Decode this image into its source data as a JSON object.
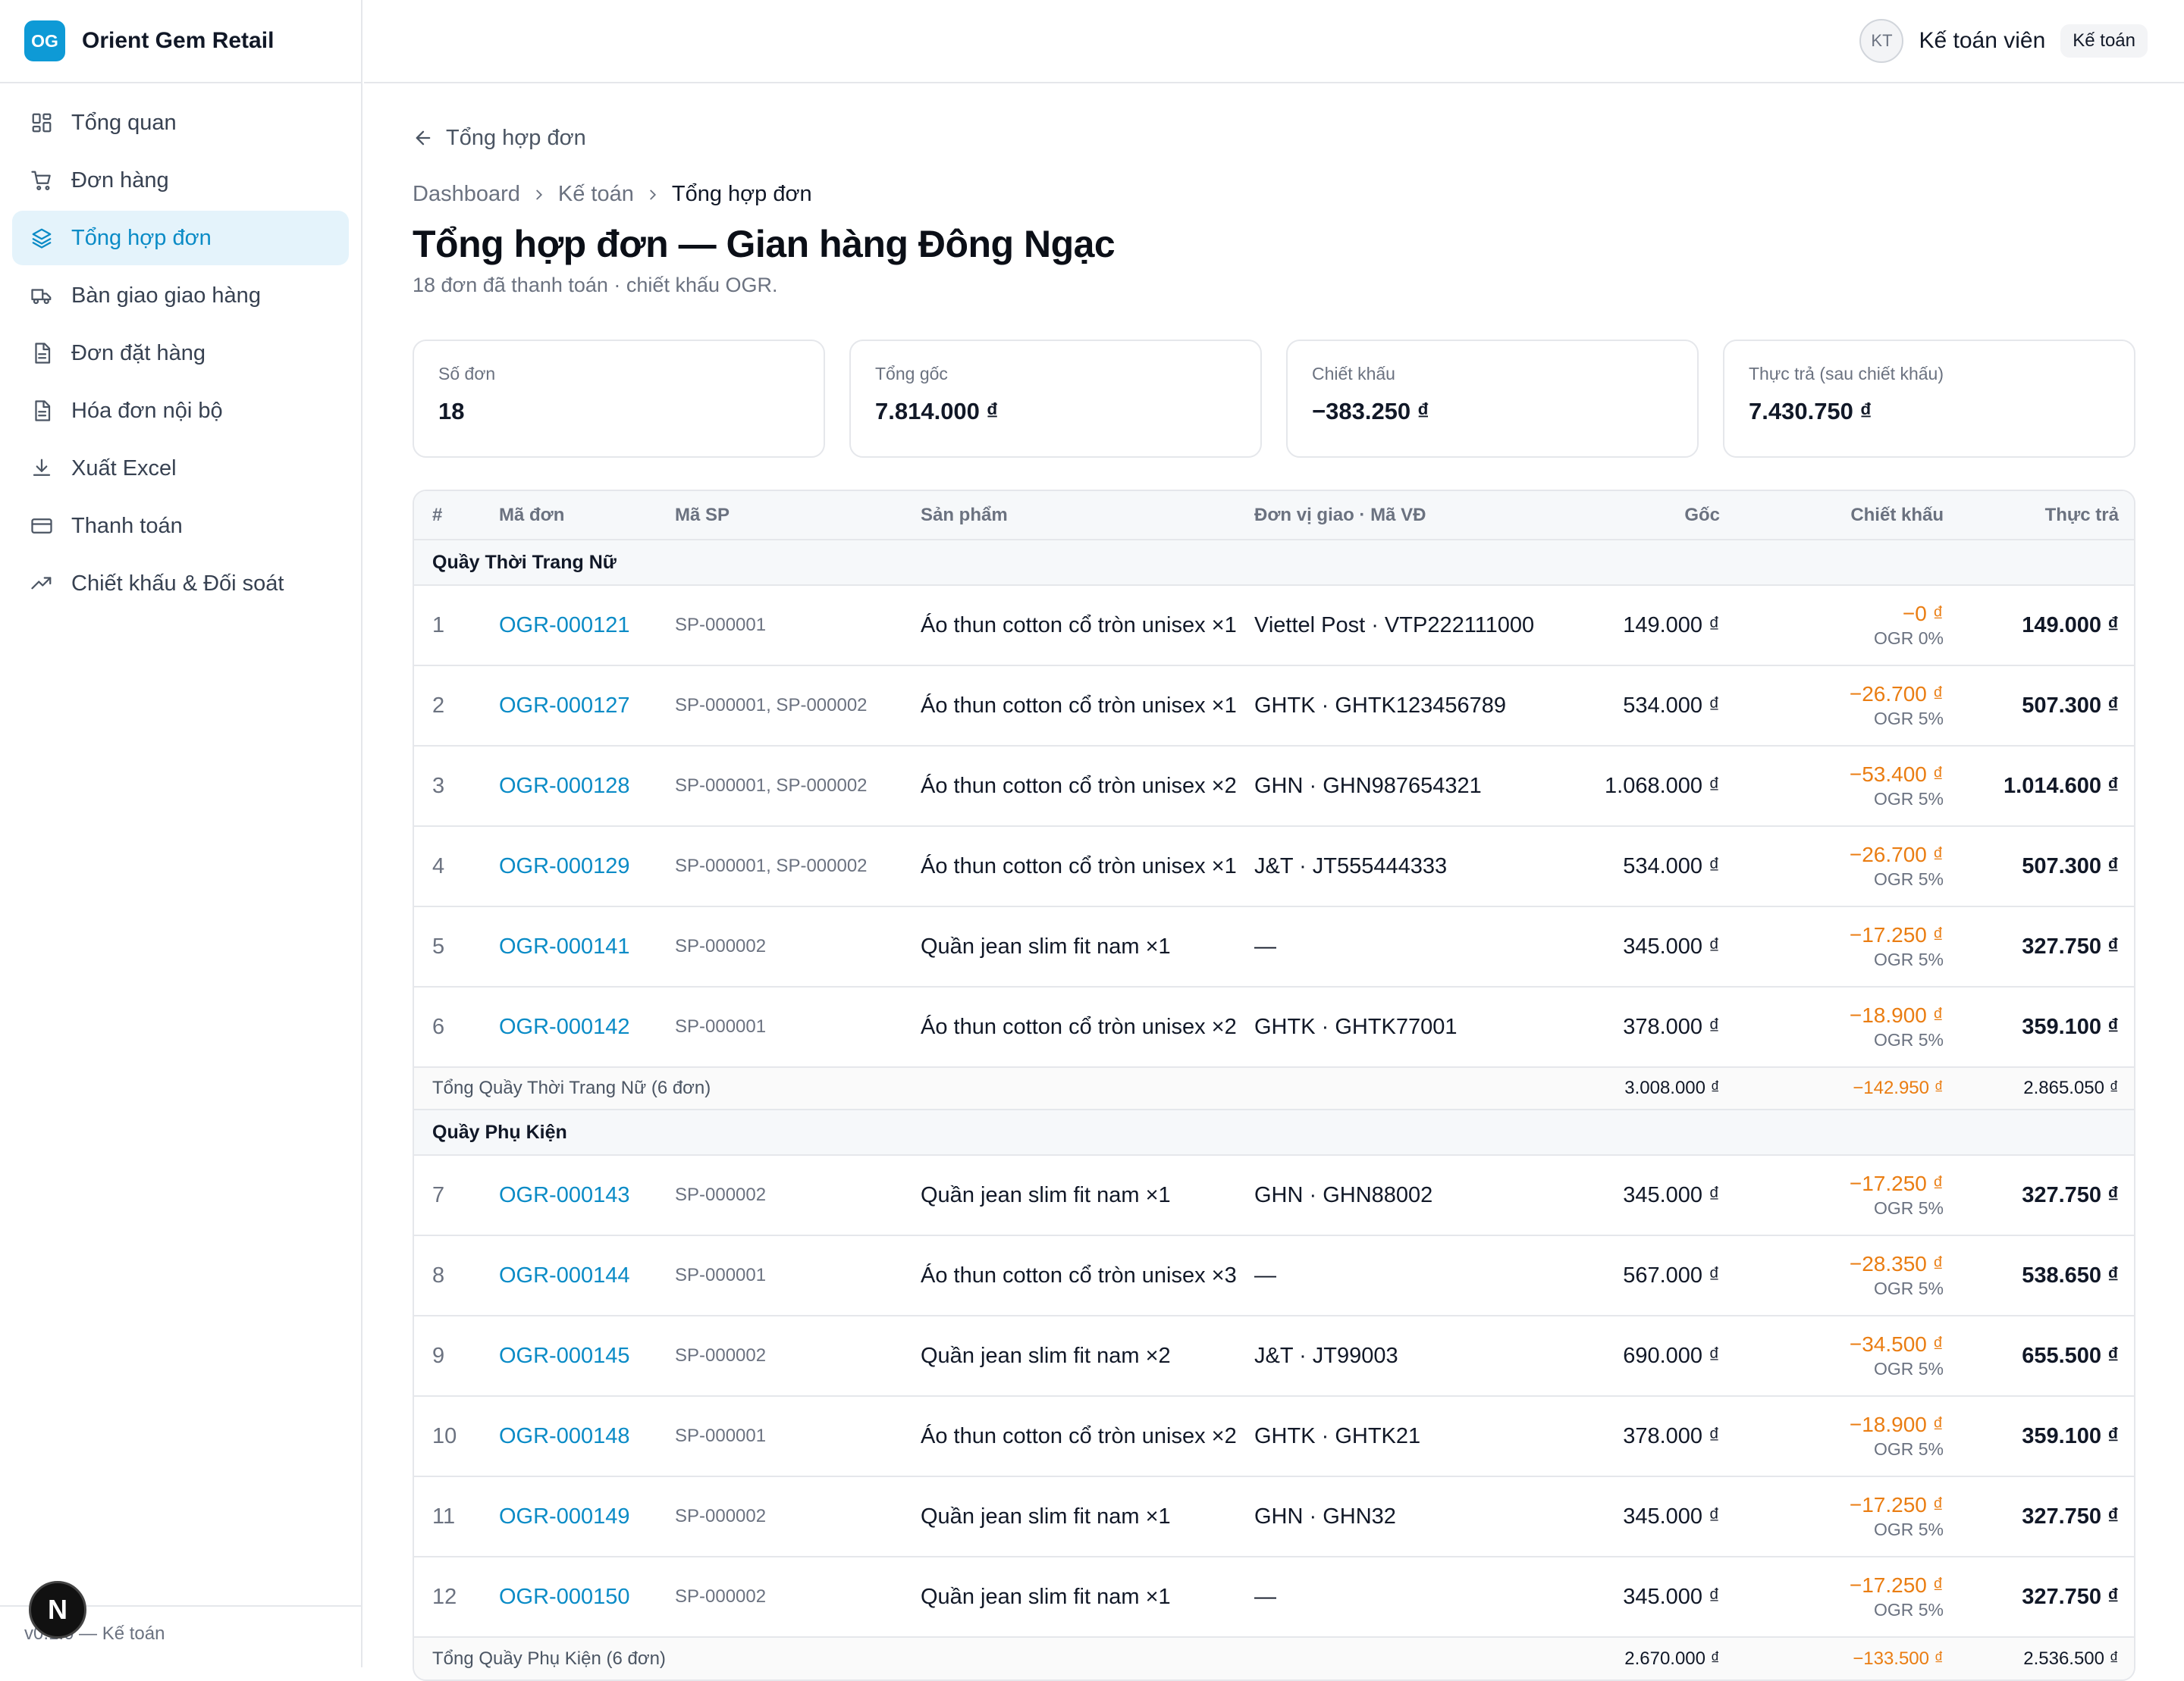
{
  "app": {
    "logo": "OG",
    "name": "Orient Gem Retail",
    "footer": "v0.1.0 — Kế toán",
    "dev_badge": "N"
  },
  "sidebar": {
    "items": [
      {
        "label": "Tổng quan",
        "icon": "dashboard-icon"
      },
      {
        "label": "Đơn hàng",
        "icon": "cart-icon"
      },
      {
        "label": "Tổng hợp đơn",
        "icon": "layers-icon",
        "active": true
      },
      {
        "label": "Bàn giao giao hàng",
        "icon": "truck-icon"
      },
      {
        "label": "Đơn đặt hàng",
        "icon": "document-icon"
      },
      {
        "label": "Hóa đơn nội bộ",
        "icon": "document-icon"
      },
      {
        "label": "Xuất Excel",
        "icon": "download-icon"
      },
      {
        "label": "Thanh toán",
        "icon": "credit-card-icon"
      },
      {
        "label": "Chiết khấu & Đối soát",
        "icon": "trend-icon"
      }
    ]
  },
  "topbar": {
    "avatar": "KT",
    "user": "Kế toán viên",
    "role": "Kế toán"
  },
  "page": {
    "back": "Tổng hợp đơn",
    "breadcrumb": [
      "Dashboard",
      "Kế toán",
      "Tổng hợp đơn"
    ],
    "title": "Tổng hợp đơn — Gian hàng Đông Ngạc",
    "subtitle": "18 đơn đã thanh toán · chiết khấu OGR."
  },
  "stats": [
    {
      "label": "Số đơn",
      "value": "18"
    },
    {
      "label": "Tổng gốc",
      "value": "7.814.000 ₫"
    },
    {
      "label": "Chiết khấu",
      "value": "−383.250 ₫"
    },
    {
      "label": "Thực trả (sau chiết khấu)",
      "value": "7.430.750 ₫"
    }
  ],
  "table": {
    "headers": {
      "idx": "#",
      "code": "Mã đơn",
      "sp": "Mã SP",
      "prod": "Sản phẩm",
      "ship": "Đơn vị giao · Mã VĐ",
      "goc": "Gốc",
      "ck": "Chiết khấu",
      "tt": "Thực trả"
    },
    "groups": [
      {
        "name": "Quầy Thời Trang Nữ",
        "rows": [
          {
            "idx": "1",
            "code": "OGR-000121",
            "sp": "SP-000001",
            "prod": "Áo thun cotton cổ tròn unisex ×1",
            "ship": "Viettel Post · VTP222111000",
            "goc": "149.000 ₫",
            "ck": "−0 ₫",
            "rate": "OGR 0%",
            "tt": "149.000 ₫"
          },
          {
            "idx": "2",
            "code": "OGR-000127",
            "sp": "SP-000001, SP-000002",
            "prod": "Áo thun cotton cổ tròn unisex ×1",
            "ship": "GHTK · GHTK123456789",
            "goc": "534.000 ₫",
            "ck": "−26.700 ₫",
            "rate": "OGR 5%",
            "tt": "507.300 ₫"
          },
          {
            "idx": "3",
            "code": "OGR-000128",
            "sp": "SP-000001, SP-000002",
            "prod": "Áo thun cotton cổ tròn unisex ×2",
            "ship": "GHN · GHN987654321",
            "goc": "1.068.000 ₫",
            "ck": "−53.400 ₫",
            "rate": "OGR 5%",
            "tt": "1.014.600 ₫"
          },
          {
            "idx": "4",
            "code": "OGR-000129",
            "sp": "SP-000001, SP-000002",
            "prod": "Áo thun cotton cổ tròn unisex ×1",
            "ship": "J&T · JT555444333",
            "goc": "534.000 ₫",
            "ck": "−26.700 ₫",
            "rate": "OGR 5%",
            "tt": "507.300 ₫"
          },
          {
            "idx": "5",
            "code": "OGR-000141",
            "sp": "SP-000002",
            "prod": "Quần jean slim fit nam ×1",
            "ship": "—",
            "goc": "345.000 ₫",
            "ck": "−17.250 ₫",
            "rate": "OGR 5%",
            "tt": "327.750 ₫"
          },
          {
            "idx": "6",
            "code": "OGR-000142",
            "sp": "SP-000001",
            "prod": "Áo thun cotton cổ tròn unisex ×2",
            "ship": "GHTK · GHTK77001",
            "goc": "378.000 ₫",
            "ck": "−18.900 ₫",
            "rate": "OGR 5%",
            "tt": "359.100 ₫"
          }
        ],
        "subtotal": {
          "label": "Tổng Quầy Thời Trang Nữ (6 đơn)",
          "goc": "3.008.000 ₫",
          "ck": "−142.950 ₫",
          "tt": "2.865.050 ₫"
        }
      },
      {
        "name": "Quầy Phụ Kiện",
        "rows": [
          {
            "idx": "7",
            "code": "OGR-000143",
            "sp": "SP-000002",
            "prod": "Quần jean slim fit nam ×1",
            "ship": "GHN · GHN88002",
            "goc": "345.000 ₫",
            "ck": "−17.250 ₫",
            "rate": "OGR 5%",
            "tt": "327.750 ₫"
          },
          {
            "idx": "8",
            "code": "OGR-000144",
            "sp": "SP-000001",
            "prod": "Áo thun cotton cổ tròn unisex ×3",
            "ship": "—",
            "goc": "567.000 ₫",
            "ck": "−28.350 ₫",
            "rate": "OGR 5%",
            "tt": "538.650 ₫"
          },
          {
            "idx": "9",
            "code": "OGR-000145",
            "sp": "SP-000002",
            "prod": "Quần jean slim fit nam ×2",
            "ship": "J&T · JT99003",
            "goc": "690.000 ₫",
            "ck": "−34.500 ₫",
            "rate": "OGR 5%",
            "tt": "655.500 ₫"
          },
          {
            "idx": "10",
            "code": "OGR-000148",
            "sp": "SP-000001",
            "prod": "Áo thun cotton cổ tròn unisex ×2",
            "ship": "GHTK · GHTK21",
            "goc": "378.000 ₫",
            "ck": "−18.900 ₫",
            "rate": "OGR 5%",
            "tt": "359.100 ₫"
          },
          {
            "idx": "11",
            "code": "OGR-000149",
            "sp": "SP-000002",
            "prod": "Quần jean slim fit nam ×1",
            "ship": "GHN · GHN32",
            "goc": "345.000 ₫",
            "ck": "−17.250 ₫",
            "rate": "OGR 5%",
            "tt": "327.750 ₫"
          },
          {
            "idx": "12",
            "code": "OGR-000150",
            "sp": "SP-000002",
            "prod": "Quần jean slim fit nam ×1",
            "ship": "—",
            "goc": "345.000 ₫",
            "ck": "−17.250 ₫",
            "rate": "OGR 5%",
            "tt": "327.750 ₫"
          }
        ],
        "subtotal": {
          "label": "Tổng Quầy Phụ Kiện (6 đơn)",
          "goc": "2.670.000 ₫",
          "ck": "−133.500 ₫",
          "tt": "2.536.500 ₫"
        }
      }
    ]
  }
}
